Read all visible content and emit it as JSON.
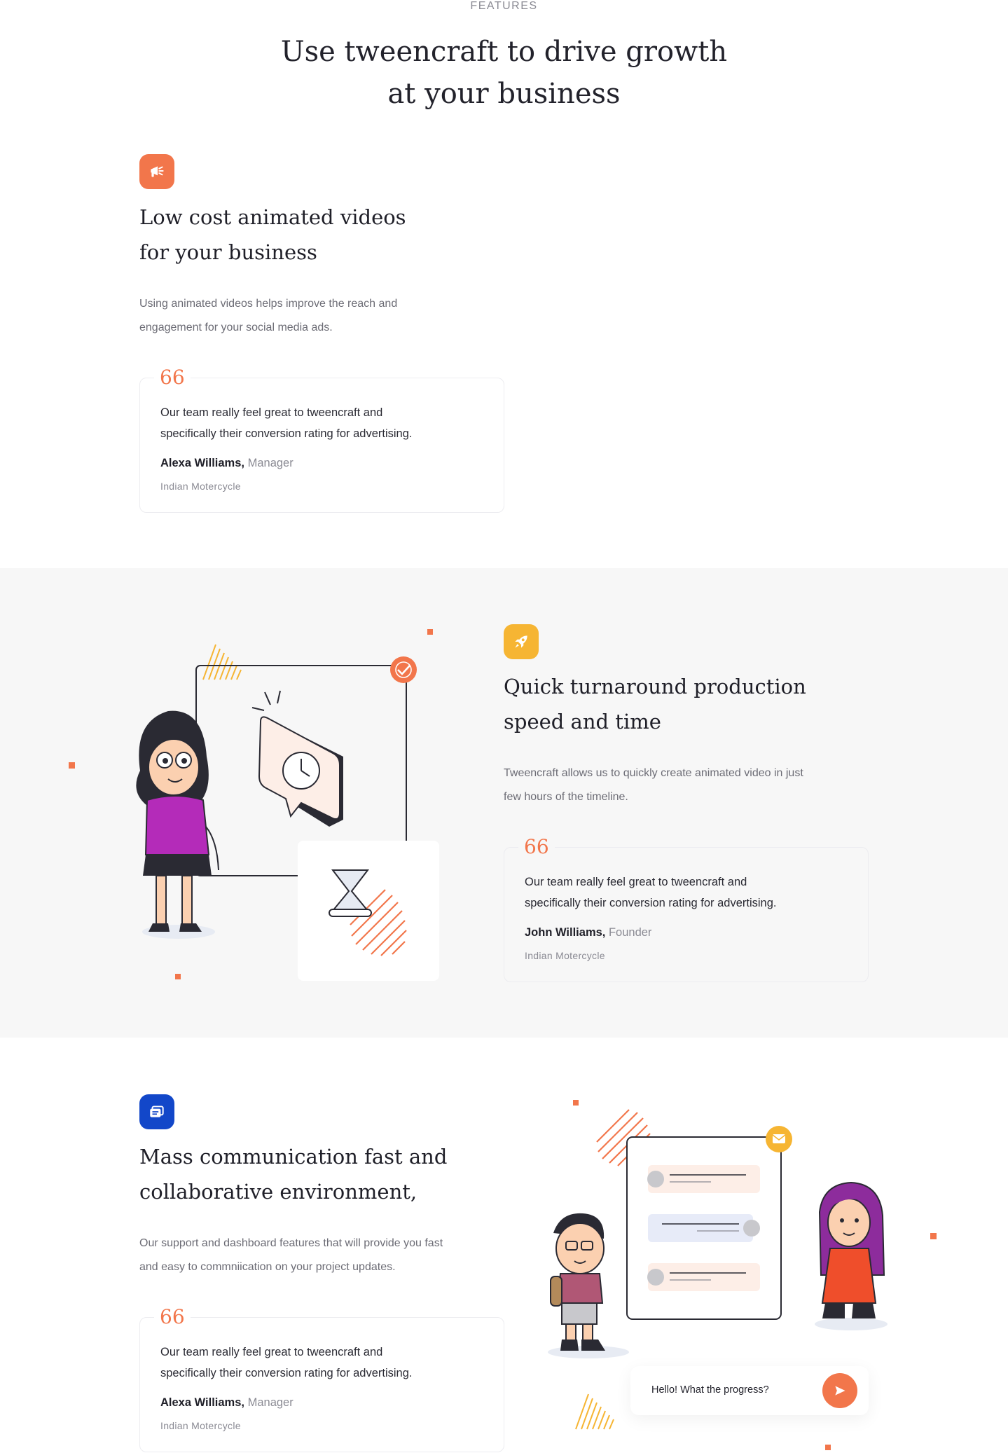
{
  "header": {
    "eyebrow": "FEATURES",
    "title_line1": "Use tweencraft to drive growth",
    "title_line2": "at your business"
  },
  "features": [
    {
      "icon": "megaphone-icon",
      "icon_color": "#f2764b",
      "title_line1": "Low cost animated videos",
      "title_line2": "for your business",
      "desc_line1": "Using animated videos helps improve the reach and",
      "desc_line2": "engagement for your social media ads.",
      "quote_mark": "66",
      "quote_line1": "Our team really feel great to tweencraft and",
      "quote_line2": "specifically their conversion rating for advertising.",
      "author": "Alexa Williams,",
      "role": "Manager",
      "company": "Indian Motercycle"
    },
    {
      "icon": "rocket-icon",
      "icon_color": "#f6b533",
      "title_line1": "Quick turnaround production",
      "title_line2": "speed and time",
      "desc_line1": "Tweencraft allows us to quickly create animated video in just",
      "desc_line2": "few hours of the timeline.",
      "quote_mark": "66",
      "quote_line1": "Our team really feel great to tweencraft and",
      "quote_line2": "specifically their conversion rating for advertising.",
      "author": "John Williams,",
      "role": "Founder",
      "company": "Indian Motercycle"
    },
    {
      "icon": "chat-icon",
      "icon_color": "#1247c9",
      "title_line1": "Mass communication fast and",
      "title_line2": "collaborative environment,",
      "desc_line1": "Our support and dashboard features that will provide you fast",
      "desc_line2": "and easy to commniication on your project updates.",
      "quote_mark": "66",
      "quote_line1": "Our team really feel great to tweencraft and",
      "quote_line2": "specifically their conversion rating for advertising.",
      "author": "Alexa Williams,",
      "role": "Manager",
      "company": "Indian Motercycle"
    }
  ],
  "chat": {
    "message": "Hello! What the progress?"
  },
  "colors": {
    "accent": "#f2764b",
    "yellow": "#f6b533",
    "blue": "#1247c9"
  }
}
